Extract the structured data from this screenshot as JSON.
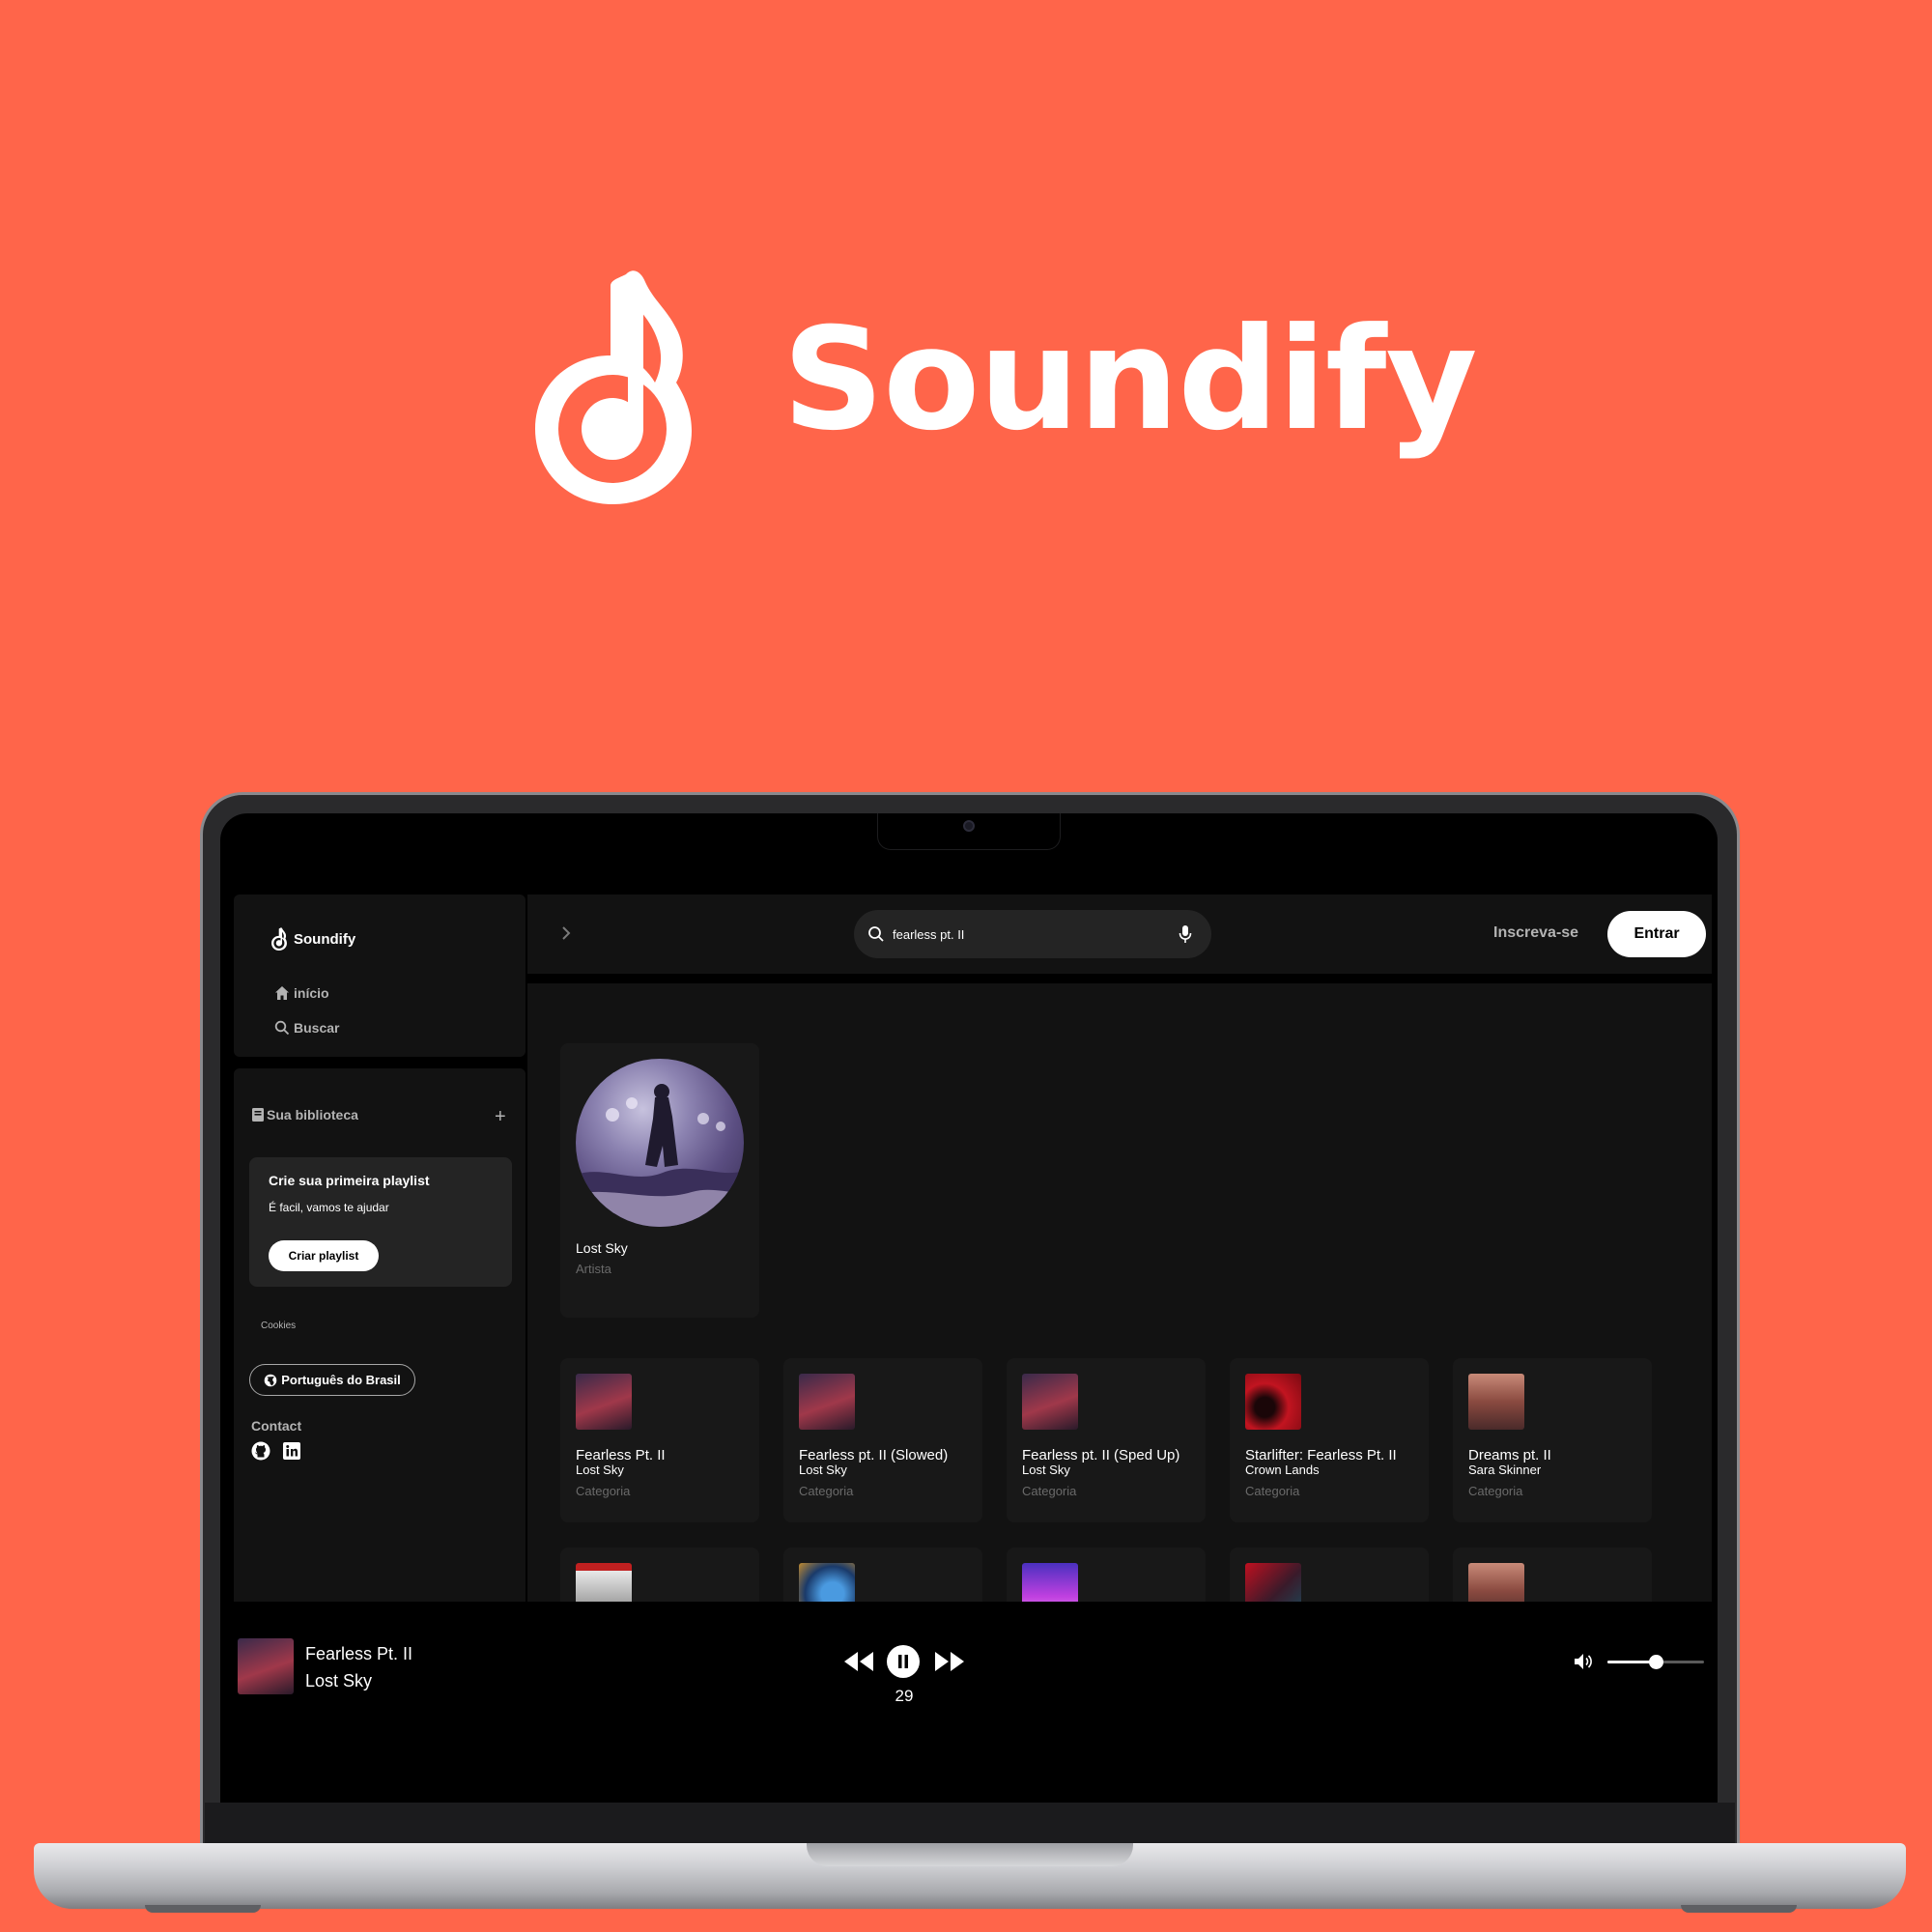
{
  "hero": {
    "title": "Soundify"
  },
  "sidebar": {
    "brand": "Soundify",
    "nav": [
      {
        "label": "início",
        "icon": "home-icon"
      },
      {
        "label": "Buscar",
        "icon": "search-icon"
      }
    ],
    "library": {
      "title": "Sua biblioteca",
      "add_icon": "plus-icon",
      "playlist_card": {
        "title": "Crie sua primeira playlist",
        "subtitle": "É facil, vamos te ajudar",
        "button": "Criar playlist"
      },
      "cookies": "Cookies",
      "language": "Português do Brasil",
      "contact_label": "Contact",
      "contact_icons": [
        "github-icon",
        "linkedin-icon"
      ]
    }
  },
  "topbar": {
    "search_value": "fearless pt. II",
    "signup": "Inscreva-se",
    "login": "Entrar"
  },
  "artist": {
    "name": "Lost Sky",
    "type": "Artista"
  },
  "tracks": [
    {
      "title": "Fearless Pt. II",
      "artist": "Lost Sky",
      "category": "Categoria",
      "color": "#7a3a4a"
    },
    {
      "title": "Fearless pt. II (Slowed)",
      "artist": "Lost Sky",
      "category": "Categoria",
      "color": "#7a3a4a"
    },
    {
      "title": "Fearless pt. II (Sped Up)",
      "artist": "Lost Sky",
      "category": "Categoria",
      "color": "#7a3a4a"
    },
    {
      "title": "Starlifter: Fearless Pt. II",
      "artist": "Crown Lands",
      "category": "Categoria",
      "color": "#b3101c"
    },
    {
      "title": "Dreams pt. II",
      "artist": "Sara Skinner",
      "category": "Categoria",
      "color": "#8a4a40"
    }
  ],
  "tracks_row2_colors": [
    "#d8d8d8",
    "#2a6aa8",
    "#8a40d8",
    "#8a1a2a",
    "#9a5040"
  ],
  "player": {
    "title": "Fearless Pt. II",
    "artist": "Lost Sky",
    "time": "29",
    "volume_fraction": 0.5
  },
  "colors": {
    "brand_background": "#ff654a",
    "app_background": "#121212",
    "card_background": "#181818"
  }
}
